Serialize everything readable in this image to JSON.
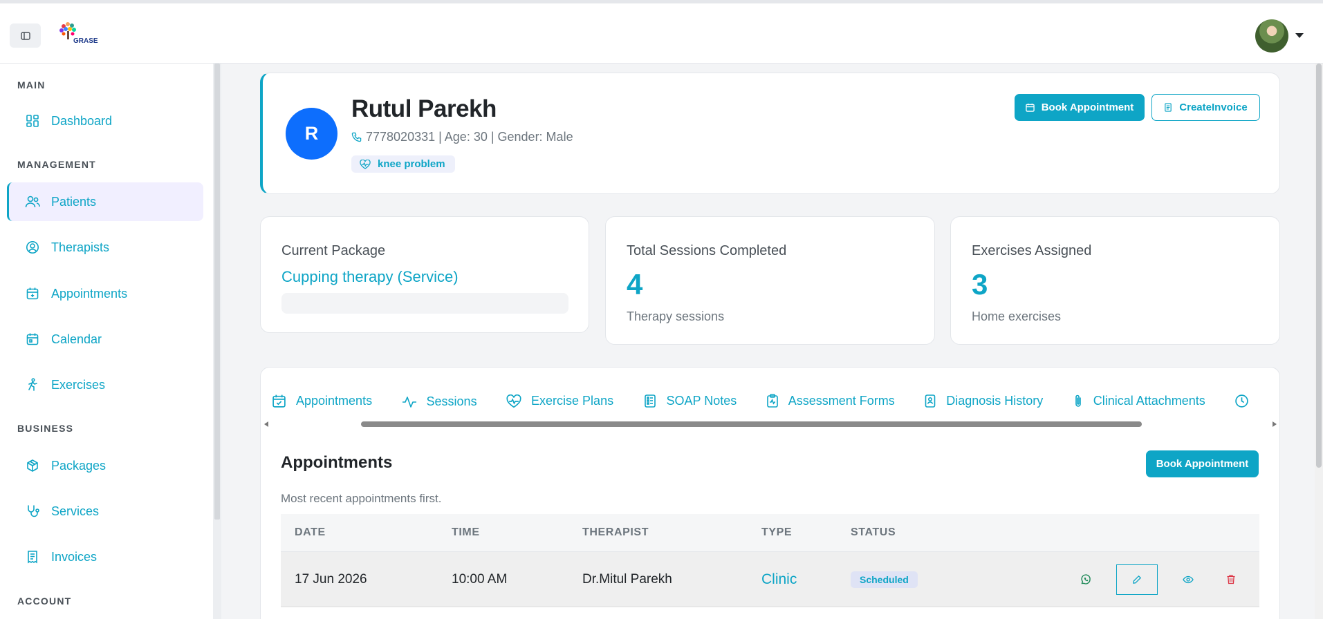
{
  "topbar": {
    "logo_text": "GRASE"
  },
  "sidebar": {
    "sections": {
      "main": "MAIN",
      "management": "MANAGEMENT",
      "business": "BUSINESS",
      "account": "ACCOUNT"
    },
    "items": [
      {
        "label": "Dashboard",
        "icon": "dashboard-icon"
      },
      {
        "label": "Patients",
        "icon": "users-icon",
        "active": true
      },
      {
        "label": "Therapists",
        "icon": "user-circle-icon"
      },
      {
        "label": "Appointments",
        "icon": "calendar-plus-icon"
      },
      {
        "label": "Calendar",
        "icon": "calendar-icon"
      },
      {
        "label": "Exercises",
        "icon": "running-icon"
      },
      {
        "label": "Packages",
        "icon": "package-icon"
      },
      {
        "label": "Services",
        "icon": "stethoscope-icon"
      },
      {
        "label": "Invoices",
        "icon": "invoice-icon"
      }
    ]
  },
  "patient": {
    "initial": "R",
    "name": "Rutul Parekh",
    "info": "7778020331 | Age: 30 | Gender: Male",
    "condition": "knee problem",
    "book_label": "Book Appointment",
    "invoice_label": "CreateInvoice"
  },
  "stats": {
    "package_title": "Current Package",
    "package_name": "Cupping therapy (Service)",
    "sessions_title": "Total Sessions Completed",
    "sessions_count": "4",
    "sessions_sub": "Therapy sessions",
    "exercises_title": "Exercises Assigned",
    "exercises_count": "3",
    "exercises_sub": "Home exercises"
  },
  "tabs": [
    {
      "label": "Appointments",
      "icon": "calendar-check-icon"
    },
    {
      "label": "Sessions",
      "icon": "activity-icon"
    },
    {
      "label": "Exercise Plans",
      "icon": "heart-pulse-icon"
    },
    {
      "label": "SOAP Notes",
      "icon": "notes-icon"
    },
    {
      "label": "Assessment Forms",
      "icon": "clipboard-pulse-icon"
    },
    {
      "label": "Diagnosis History",
      "icon": "document-person-icon"
    },
    {
      "label": "Clinical Attachments",
      "icon": "paperclip-icon"
    },
    {
      "label": "",
      "icon": "clock-icon"
    }
  ],
  "appointments": {
    "title": "Appointments",
    "subtitle": "Most recent appointments first.",
    "book_label": "Book Appointment",
    "headers": [
      "DATE",
      "TIME",
      "THERAPIST",
      "TYPE",
      "STATUS"
    ],
    "rows": [
      {
        "date": "17 Jun 2026",
        "time": "10:00 AM",
        "therapist": "Dr.Mitul Parekh",
        "type": "Clinic",
        "status": "Scheduled"
      }
    ]
  },
  "colors": {
    "accent": "#0ea5c6",
    "avatar_blue": "#0d6efd",
    "delete_red": "#dc3545",
    "whatsapp_green": "#198754"
  }
}
